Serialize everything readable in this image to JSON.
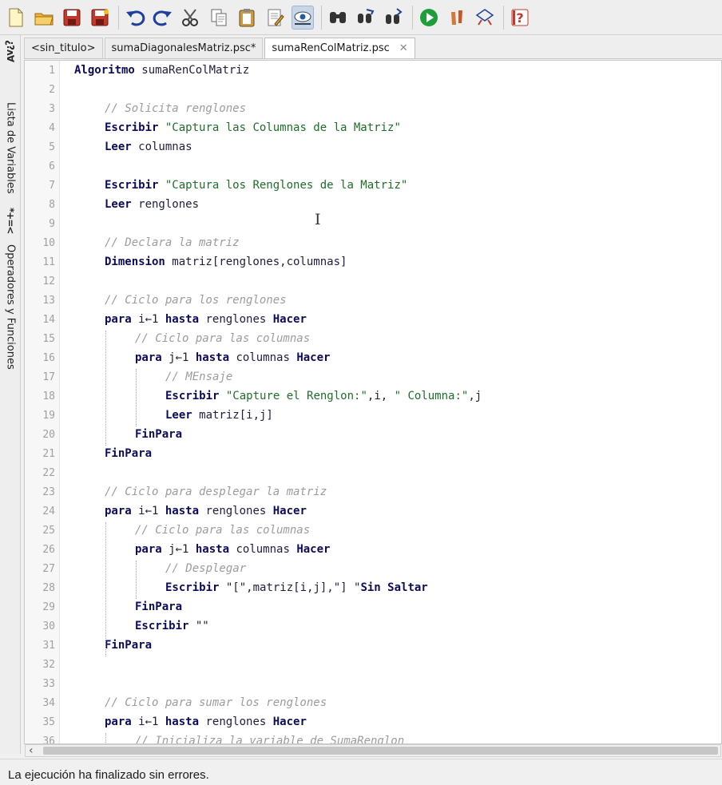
{
  "toolbar": {
    "buttons": [
      "new-file",
      "open-file",
      "save-file",
      "save-as",
      "undo",
      "redo",
      "cut",
      "copy",
      "paste",
      "edit",
      "pseudocode-view",
      "search",
      "replace",
      "search-next",
      "run",
      "run-step",
      "flowchart",
      "help"
    ]
  },
  "sidebar": {
    "variables_label": "Lista de Variables",
    "variables_icon": "¿?ʌ∀",
    "operators_label": "Operadores y Funciones",
    "operators_icon": "*+=<"
  },
  "tabs": [
    {
      "label": "<sin_titulo>"
    },
    {
      "label": "sumaDiagonalesMatriz.psc*"
    },
    {
      "label": "sumaRenColMatriz.psc",
      "close": "✕"
    }
  ],
  "editor": {
    "lines": [
      {
        "n": "1",
        "indent": 0,
        "parts": [
          {
            "t": "Algoritmo",
            "c": "kw"
          },
          {
            "t": " sumaRenColMatriz",
            "c": ""
          }
        ]
      },
      {
        "n": "2",
        "indent": 0,
        "parts": []
      },
      {
        "n": "3",
        "indent": 1,
        "parts": [
          {
            "t": "// Solicita renglones",
            "c": "cmt"
          }
        ]
      },
      {
        "n": "4",
        "indent": 1,
        "parts": [
          {
            "t": "Escribir",
            "c": "kw"
          },
          {
            "t": " ",
            "c": ""
          },
          {
            "t": "\"Captura las Columnas de la Matriz\"",
            "c": "str"
          }
        ]
      },
      {
        "n": "5",
        "indent": 1,
        "parts": [
          {
            "t": "Leer",
            "c": "kw"
          },
          {
            "t": " columnas",
            "c": ""
          }
        ]
      },
      {
        "n": "6",
        "indent": 0,
        "parts": []
      },
      {
        "n": "7",
        "indent": 1,
        "parts": [
          {
            "t": "Escribir",
            "c": "kw"
          },
          {
            "t": " ",
            "c": ""
          },
          {
            "t": "\"Captura los Renglones de la Matriz\"",
            "c": "str"
          }
        ]
      },
      {
        "n": "8",
        "indent": 1,
        "parts": [
          {
            "t": "Leer",
            "c": "kw"
          },
          {
            "t": " renglones",
            "c": ""
          }
        ]
      },
      {
        "n": "9",
        "indent": 0,
        "parts": []
      },
      {
        "n": "10",
        "indent": 1,
        "parts": [
          {
            "t": "// Declara la matriz",
            "c": "cmt"
          }
        ]
      },
      {
        "n": "11",
        "indent": 1,
        "parts": [
          {
            "t": "Dimension",
            "c": "kw"
          },
          {
            "t": " matriz[renglones,columnas]",
            "c": ""
          }
        ]
      },
      {
        "n": "12",
        "indent": 0,
        "parts": []
      },
      {
        "n": "13",
        "indent": 1,
        "parts": [
          {
            "t": "// Ciclo para los renglones",
            "c": "cmt"
          }
        ]
      },
      {
        "n": "14",
        "indent": 1,
        "parts": [
          {
            "t": "para",
            "c": "kw"
          },
          {
            "t": " i←1 ",
            "c": ""
          },
          {
            "t": "hasta",
            "c": "kw"
          },
          {
            "t": " renglones ",
            "c": ""
          },
          {
            "t": "Hacer",
            "c": "kw"
          }
        ]
      },
      {
        "n": "15",
        "indent": 2,
        "parts": [
          {
            "t": "// Ciclo para las columnas",
            "c": "cmt"
          }
        ]
      },
      {
        "n": "16",
        "indent": 2,
        "parts": [
          {
            "t": "para",
            "c": "kw"
          },
          {
            "t": " j←1 ",
            "c": ""
          },
          {
            "t": "hasta",
            "c": "kw"
          },
          {
            "t": " columnas ",
            "c": ""
          },
          {
            "t": "Hacer",
            "c": "kw"
          }
        ]
      },
      {
        "n": "17",
        "indent": 3,
        "parts": [
          {
            "t": "// MEnsaje",
            "c": "cmt"
          }
        ]
      },
      {
        "n": "18",
        "indent": 3,
        "parts": [
          {
            "t": "Escribir",
            "c": "kw"
          },
          {
            "t": " ",
            "c": ""
          },
          {
            "t": "\"Capture el Renglon:\"",
            "c": "str"
          },
          {
            "t": ",i, ",
            "c": ""
          },
          {
            "t": "\" Columna:\"",
            "c": "str"
          },
          {
            "t": ",j",
            "c": ""
          }
        ]
      },
      {
        "n": "19",
        "indent": 3,
        "parts": [
          {
            "t": "Leer",
            "c": "kw"
          },
          {
            "t": " matriz[i,j]",
            "c": ""
          }
        ]
      },
      {
        "n": "20",
        "indent": 2,
        "parts": [
          {
            "t": "FinPara",
            "c": "kw"
          }
        ]
      },
      {
        "n": "21",
        "indent": 1,
        "parts": [
          {
            "t": "FinPara",
            "c": "kw"
          }
        ]
      },
      {
        "n": "22",
        "indent": 0,
        "parts": []
      },
      {
        "n": "23",
        "indent": 1,
        "parts": [
          {
            "t": "// Ciclo para desplegar la matriz",
            "c": "cmt"
          }
        ]
      },
      {
        "n": "24",
        "indent": 1,
        "parts": [
          {
            "t": "para",
            "c": "kw"
          },
          {
            "t": " i←1 ",
            "c": ""
          },
          {
            "t": "hasta",
            "c": "kw"
          },
          {
            "t": " renglones ",
            "c": ""
          },
          {
            "t": "Hacer",
            "c": "kw"
          }
        ]
      },
      {
        "n": "25",
        "indent": 2,
        "parts": [
          {
            "t": "// Ciclo para las columnas",
            "c": "cmt"
          }
        ]
      },
      {
        "n": "26",
        "indent": 2,
        "parts": [
          {
            "t": "para",
            "c": "kw"
          },
          {
            "t": " j←1 ",
            "c": ""
          },
          {
            "t": "hasta",
            "c": "kw"
          },
          {
            "t": " columnas ",
            "c": ""
          },
          {
            "t": "Hacer",
            "c": "kw"
          }
        ]
      },
      {
        "n": "27",
        "indent": 3,
        "parts": [
          {
            "t": "// Desplegar",
            "c": "cmt"
          }
        ]
      },
      {
        "n": "28",
        "indent": 3,
        "parts": [
          {
            "t": "Escribir",
            "c": "kw"
          },
          {
            "t": " \"[\",matriz[i,j],\"] \"",
            "c": ""
          },
          {
            "t": "Sin Saltar",
            "c": "kw"
          }
        ]
      },
      {
        "n": "29",
        "indent": 2,
        "parts": [
          {
            "t": "FinPara",
            "c": "kw"
          }
        ]
      },
      {
        "n": "30",
        "indent": 2,
        "parts": [
          {
            "t": "Escribir",
            "c": "kw"
          },
          {
            "t": " \"\"",
            "c": ""
          }
        ]
      },
      {
        "n": "31",
        "indent": 1,
        "parts": [
          {
            "t": "FinPara",
            "c": "kw"
          }
        ]
      },
      {
        "n": "32",
        "indent": 0,
        "parts": []
      },
      {
        "n": "33",
        "indent": 0,
        "parts": []
      },
      {
        "n": "34",
        "indent": 1,
        "parts": [
          {
            "t": "// Ciclo para sumar los renglones",
            "c": "cmt"
          }
        ]
      },
      {
        "n": "35",
        "indent": 1,
        "parts": [
          {
            "t": "para",
            "c": "kw"
          },
          {
            "t": " i←1 ",
            "c": ""
          },
          {
            "t": "hasta",
            "c": "kw"
          },
          {
            "t": " renglones ",
            "c": ""
          },
          {
            "t": "Hacer",
            "c": "kw"
          }
        ]
      },
      {
        "n": "36",
        "indent": 2,
        "parts": [
          {
            "t": "// Inicializa la variable de SumaRenglon",
            "c": "cmt"
          }
        ]
      }
    ]
  },
  "status": {
    "text": "La ejecución ha finalizado sin errores."
  }
}
